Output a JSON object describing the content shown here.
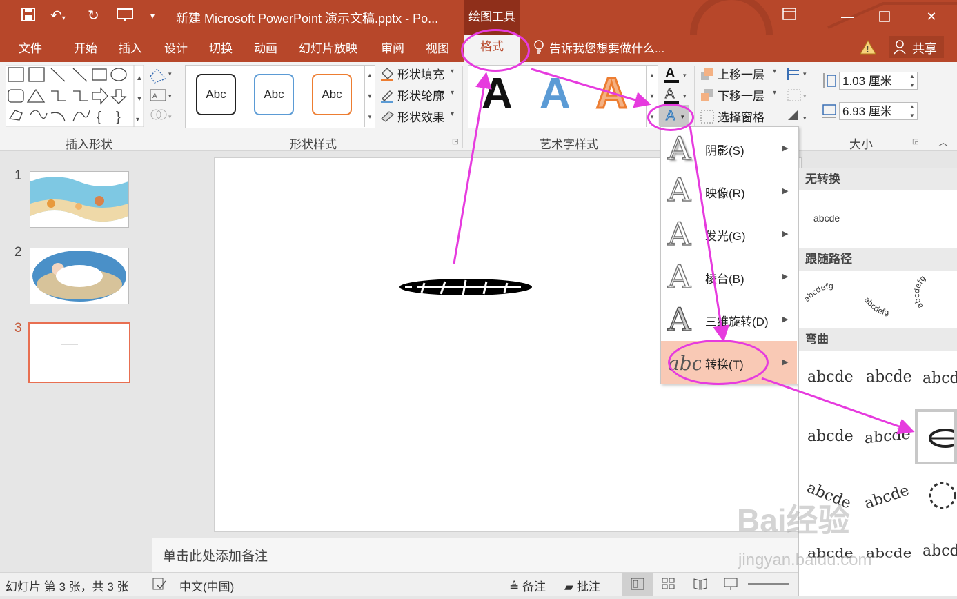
{
  "title_bar": {
    "document_title": "新建 Microsoft PowerPoint 演示文稿.pptx - Po...",
    "context_tab": "绘图工具"
  },
  "tabs": [
    "文件",
    "开始",
    "插入",
    "设计",
    "切换",
    "动画",
    "幻灯片放映",
    "审阅",
    "视图"
  ],
  "active_tab": "格式",
  "tell_me": "告诉我您想要做什么...",
  "share": "共享",
  "ribbon": {
    "insert_shapes_label": "插入形状",
    "shape_styles_label": "形状样式",
    "style_preview": "Abc",
    "shape_fill": "形状填充",
    "shape_outline": "形状轮廓",
    "shape_effects": "形状效果",
    "wordart_label": "艺术字样式",
    "wordart_letter": "A",
    "bring_forward": "上移一层",
    "send_backward": "下移一层",
    "selection_pane": "选择窗格",
    "size_label": "大小",
    "height_value": "1.03 厘米",
    "width_value": "6.93 厘米"
  },
  "slides": [
    {
      "number": "1"
    },
    {
      "number": "2"
    },
    {
      "number": "3"
    }
  ],
  "notes_placeholder": "单击此处添加备注",
  "status_bar": {
    "slide_info": "幻灯片 第 3 张，共 3 张",
    "language": "中文(中国)",
    "notes": "备注",
    "comments": "批注"
  },
  "text_effects_menu": [
    {
      "label": "阴影(S)",
      "icon": "shadow-a-icon"
    },
    {
      "label": "映像(R)",
      "icon": "reflection-a-icon"
    },
    {
      "label": "发光(G)",
      "icon": "glow-a-icon"
    },
    {
      "label": "棱台(B)",
      "icon": "bevel-a-icon"
    },
    {
      "label": "三维旋转(D)",
      "icon": "3d-rotation-a-icon"
    },
    {
      "label": "转换(T)",
      "icon": "transform-abc-icon"
    }
  ],
  "transform_gallery": {
    "no_transform_header": "无转换",
    "no_transform_sample": "abcde",
    "follow_path_header": "跟随路径",
    "warp_header": "弯曲",
    "sample": "abcde",
    "path_sample": "abcdefg"
  },
  "watermark": {
    "brand": "Bai经验",
    "url": "jingyan.baidu.com"
  },
  "colors": {
    "accent": "#b7472a",
    "annotation": "#e63bde",
    "menu_highlight": "#f9c9b5"
  }
}
